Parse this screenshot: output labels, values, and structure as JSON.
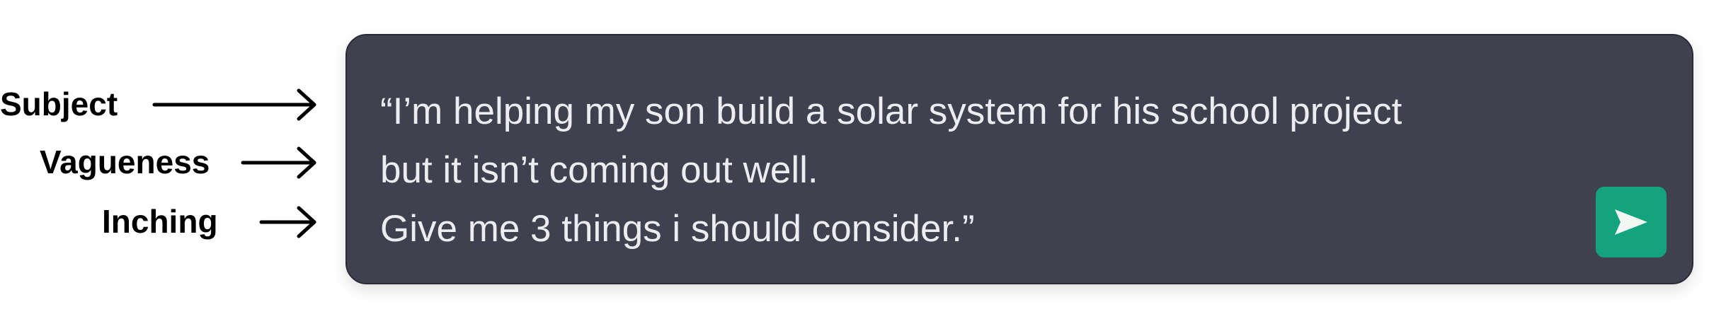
{
  "labels": {
    "subject": "Subject",
    "vagueness": "Vagueness",
    "inching": "Inching"
  },
  "prompt": {
    "lines": [
      "“I’m helping my son build a solar system for his school project",
      "but it isn’t coming out well.",
      "Give me 3 things i should consider.”"
    ]
  },
  "icons": {
    "send": "send-icon",
    "arrow": "arrow-right-icon"
  },
  "colors": {
    "box_background": "#40414f",
    "text": "#ececf1",
    "send_button": "#14a37f"
  }
}
